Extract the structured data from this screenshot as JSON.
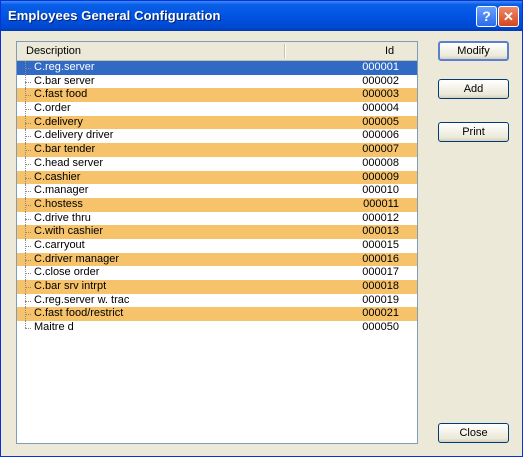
{
  "window": {
    "title": "Employees General Configuration"
  },
  "titlebar_buttons": {
    "help": "?",
    "close": "✕"
  },
  "list": {
    "columns": {
      "description": "Description",
      "id": "Id"
    },
    "rows": [
      {
        "description": "C.reg.server",
        "id": "000001"
      },
      {
        "description": "C.bar server",
        "id": "000002"
      },
      {
        "description": "C.fast food",
        "id": "000003"
      },
      {
        "description": "C.order",
        "id": "000004"
      },
      {
        "description": "C.delivery",
        "id": "000005"
      },
      {
        "description": "C.delivery driver",
        "id": "000006"
      },
      {
        "description": "C.bar tender",
        "id": "000007"
      },
      {
        "description": "C.head server",
        "id": "000008"
      },
      {
        "description": "C.cashier",
        "id": "000009"
      },
      {
        "description": "C.manager",
        "id": "000010"
      },
      {
        "description": "C.hostess",
        "id": "000011"
      },
      {
        "description": "C.drive thru",
        "id": "000012"
      },
      {
        "description": "C.with cashier",
        "id": "000013"
      },
      {
        "description": "C.carryout",
        "id": "000015"
      },
      {
        "description": "C.driver manager",
        "id": "000016"
      },
      {
        "description": "C.close order",
        "id": "000017"
      },
      {
        "description": "C.bar srv intrpt",
        "id": "000018"
      },
      {
        "description": "C.reg.server w. trac",
        "id": "000019"
      },
      {
        "description": "C.fast food/restrict",
        "id": "000021"
      },
      {
        "description": "Maitre d",
        "id": "000050"
      }
    ],
    "selected_index": 0
  },
  "buttons": {
    "modify": "Modify",
    "add": "Add",
    "print": "Print",
    "close": "Close"
  },
  "colors": {
    "titlebar": "#0054e3",
    "row_highlight": "#f6c36b",
    "selection": "#316ac5"
  }
}
